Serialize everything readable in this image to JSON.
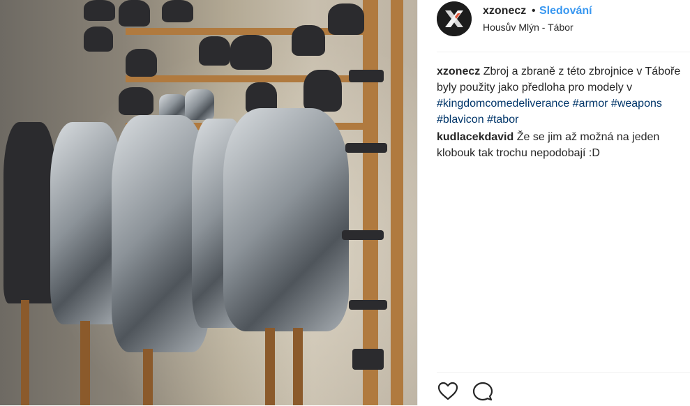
{
  "post": {
    "username": "xzonecz",
    "separator": "•",
    "follow_label": "Sledování",
    "location": "Housův Mlýn - Tábor",
    "image_alt": "Zbroj a zbraně ve zbrojnici"
  },
  "comments": [
    {
      "author": "xzonecz",
      "text": "Zbroj a zbraně z této zbrojnice v Táboře byly použity jako předloha pro modely v ",
      "tags": [
        "#kingdomcomedeliverance",
        "#armor",
        "#weapons",
        "#blavicon",
        "#tabor"
      ]
    },
    {
      "author": "kudlacekdavid",
      "text": "Že se jim až možná na jeden klobouk tak trochu nepodobají :D"
    }
  ],
  "actions": {
    "like_icon": "heart-icon",
    "comment_icon": "comment-icon"
  },
  "colors": {
    "link_blue": "#3897f0",
    "hashtag": "#003569",
    "text": "#262626",
    "avatar_bg": "#1c1c1c",
    "avatar_x_accent": "#e0573a"
  }
}
